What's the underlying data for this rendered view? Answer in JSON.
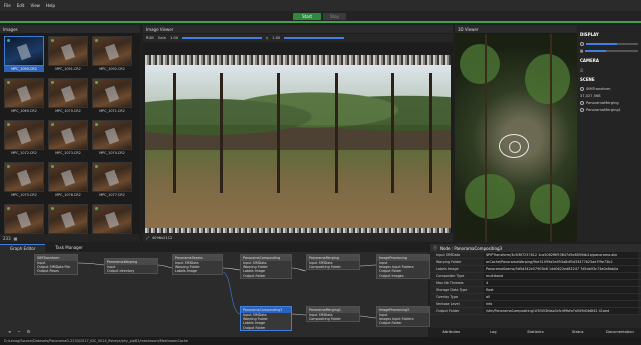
{
  "menu": [
    "File",
    "Edit",
    "View",
    "Help"
  ],
  "toolbar": {
    "start_label": "Start",
    "stop_label": "Stop"
  },
  "images_panel": {
    "title": "Images",
    "thumbs": [
      "MPC_1090.CR2",
      "MPC_1091.CR2",
      "MPC_1092.CR2",
      "MPC_1069.CR2",
      "MPC_1070.CR2",
      "MPC_1071.CR2",
      "MPC_1072.CR2",
      "MPC_1073.CR2",
      "MPC_1074.CR2",
      "MPC_1075.CR2",
      "MPC_1076.CR2",
      "MPC_1077.CR2",
      "",
      "",
      ""
    ],
    "footer_count": "233"
  },
  "viewer": {
    "title": "Image Viewer",
    "gain_label": "Gain",
    "gain_value": "1.00",
    "gamma_value": "1.00",
    "view_mode": "RGB",
    "footer_resolution": "4096x2112"
  },
  "viewer3d": {
    "title": "3D Viewer",
    "display_label": "DISPLAY",
    "camera_label": "CAMERA",
    "scene_label": "SCENE",
    "scene_items": [
      "SfMTransform",
      "PanoramaMerging",
      "PanoramaMerging1"
    ],
    "scene_stat": "37,027,568"
  },
  "graph": {
    "tabs": [
      "Graph Editor",
      "Task Manager"
    ],
    "nodes": [
      {
        "title": "SfMTransform",
        "ports": [
          "Input",
          "Output SfMData File",
          "Output Poses"
        ]
      },
      {
        "title": "PanoramaWarping",
        "ports": [
          "Input",
          "Output directory"
        ]
      },
      {
        "title": "PanoramaSeams",
        "ports": [
          "Input SfMData",
          "Warping Folder",
          "Labels Image"
        ]
      },
      {
        "title": "PanoramaCompositing",
        "ports": [
          "Input SfMData",
          "Warping Folder",
          "Labels Image",
          "Output Folder"
        ]
      },
      {
        "title": "PanoramaMerging",
        "ports": [
          "Input SfMData",
          "Compositing Folder"
        ]
      },
      {
        "title": "ImageProcessing",
        "ports": [
          "Input",
          "Images Input Folders",
          "Output Folder",
          "Output Images"
        ]
      },
      {
        "title": "PanoramaCompositing3",
        "ports": [
          "Input SfMData",
          "Warping Folder",
          "Labels Image",
          "Output Folder"
        ]
      },
      {
        "title": "PanoramaMerging1",
        "ports": [
          "Input SfMData",
          "Compositing Folder"
        ]
      },
      {
        "title": "ImageProcessing3",
        "ports": [
          "Input",
          "Images Input Folders",
          "Output Folder"
        ]
      }
    ]
  },
  "attributes": {
    "title": "Node : PanoramaCompositing3",
    "rows": [
      {
        "key": "Input SfMData",
        "value": "$PIPTransform/3c5f8f7237612 1ca5062f6f53647d5e8059db1a/panorama.abc"
      },
      {
        "key": "Warping Folder",
        "value": "orCache/PanoramaWarping/9bc51099a5a953a8df5d33477b25ae7f9e73b2"
      },
      {
        "key": "Labels Image",
        "value": "PanoramaSeams/5d5d342e57903b8 1dd0622ed83247 7d5da93c73a0a6ab/la"
      },
      {
        "key": "Compositer Type",
        "value": "multiband"
      },
      {
        "key": "Max Nb Threads",
        "value": "4"
      },
      {
        "key": "Storage Data Type",
        "value": "float"
      },
      {
        "key": "Overlay Type",
        "value": "all"
      },
      {
        "key": "Verbose Level",
        "value": "info"
      },
      {
        "key": "Output Folder",
        "value": "/sfm/PanoramaCompositing/1f3f453fdaa3cfc4f9bfa7a509d0b8f42 41aed"
      }
    ],
    "bottom_tabs": [
      "Attributes",
      "Log",
      "Statistics",
      "Status",
      "Documentation"
    ]
  },
  "status_path": "D:/Lenog/Source/Datasets/PanoramaG-2233/2017_IDC_0014_fisheye/phy_pipB1/meshroom/MeshroomCache"
}
